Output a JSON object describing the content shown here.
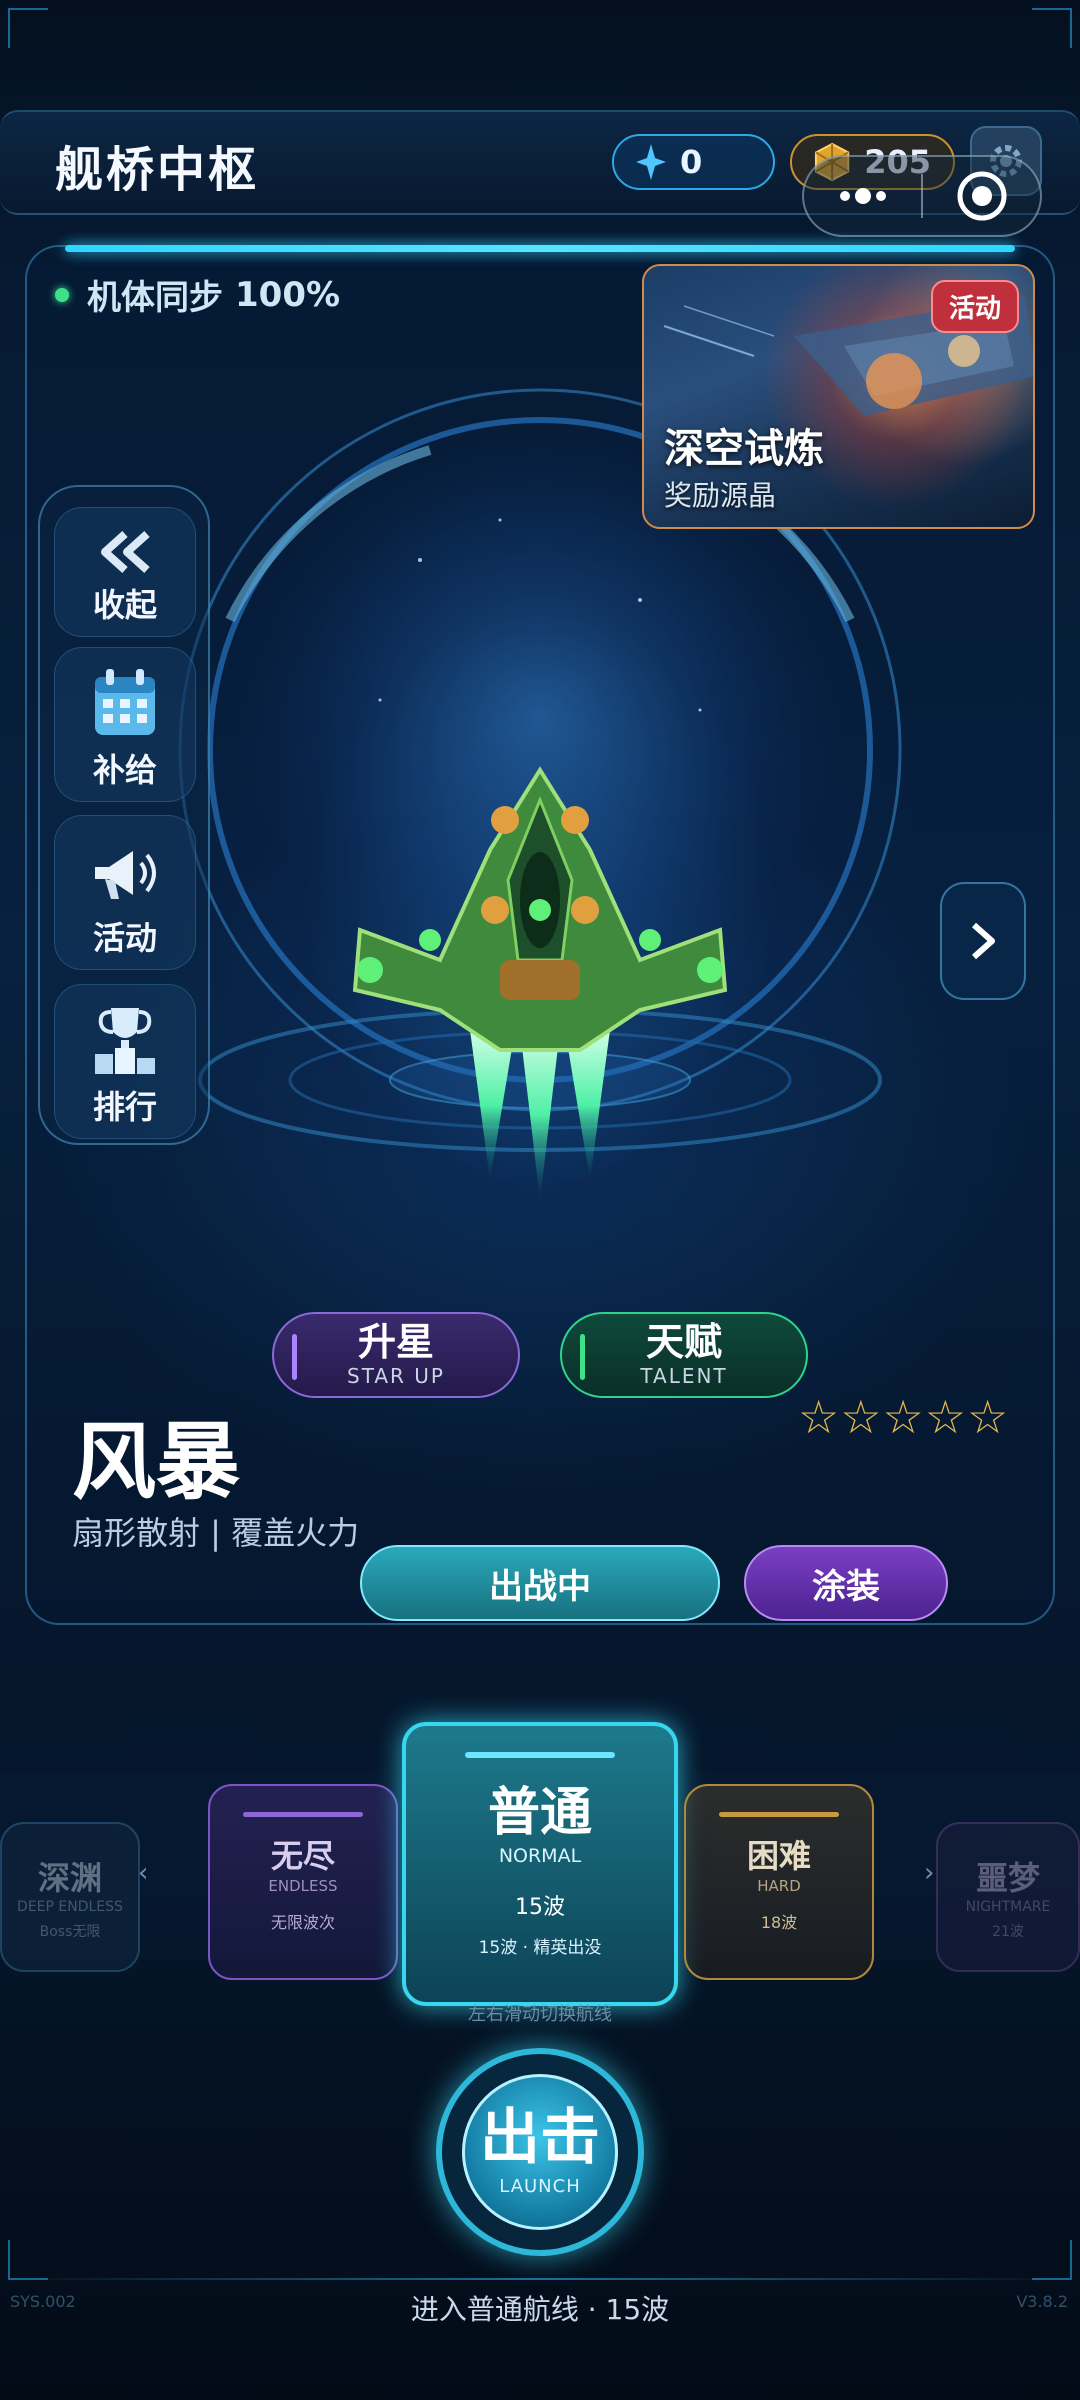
{
  "header": {
    "title": "舰桥中枢",
    "crystal_count": "0",
    "gold_count": "205"
  },
  "status": {
    "sync_label": "机体同步",
    "sync_value": "100%"
  },
  "event_card": {
    "badge": "活动",
    "title": "深空试炼",
    "subtitle": "奖励源晶"
  },
  "left_menu": [
    {
      "label": "收起",
      "icon": "double-chevron-left-icon"
    },
    {
      "label": "补给",
      "icon": "calendar-icon"
    },
    {
      "label": "活动",
      "icon": "megaphone-icon"
    },
    {
      "label": "排行",
      "icon": "trophy-icon"
    }
  ],
  "upgrade": {
    "star_up": {
      "label": "升星",
      "sub": "STAR UP"
    },
    "talent": {
      "label": "天赋",
      "sub": "TALENT"
    }
  },
  "ship": {
    "name": "风暴",
    "desc": "扇形散射 | 覆盖火力",
    "stars": 0,
    "stars_text": "☆☆☆☆☆"
  },
  "actions": {
    "deploy": "出战中",
    "skin": "涂装"
  },
  "routes": [
    {
      "name": "深渊",
      "en": "DEEP ENDLESS",
      "waves": "Boss无限"
    },
    {
      "name": "无尽",
      "en": "ENDLESS",
      "waves": "无限波次"
    },
    {
      "name": "普通",
      "en": "NORMAL",
      "waves": "15波",
      "extra": "15波 · 精英出没"
    },
    {
      "name": "困难",
      "en": "HARD",
      "waves": "18波"
    },
    {
      "name": "噩梦",
      "en": "NIGHTMARE",
      "waves": "21波"
    }
  ],
  "swipe_hint": "左右滑动切换航线",
  "launch": {
    "label": "出击",
    "sub": "LAUNCH"
  },
  "footer": {
    "enter_text": "进入普通航线 · 15波",
    "sys_left": "SYS.002",
    "sys_right": "V3.8.2"
  },
  "colors": {
    "accent_cyan": "#38d7f0",
    "gold": "#c9932f",
    "purple": "#7b55c6",
    "green": "#2fd38c",
    "badge_red": "#c0303c"
  }
}
